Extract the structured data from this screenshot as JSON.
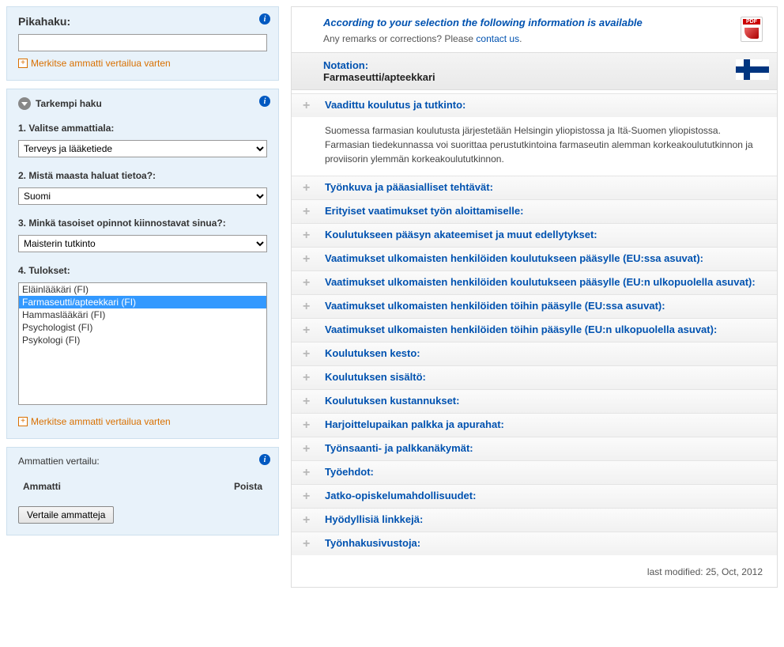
{
  "quicksearch": {
    "title": "Pikahaku:",
    "value": "",
    "mark_label": "Merkitse ammatti vertailua varten"
  },
  "advanced": {
    "title": "Tarkempi haku",
    "q1_label": "1. Valitse ammattiala:",
    "q1_value": "Terveys ja lääketiede",
    "q2_label": "2. Mistä maasta haluat tietoa?:",
    "q2_value": "Suomi",
    "q3_label": "3. Minkä tasoiset opinnot kiinnostavat sinua?:",
    "q3_value": "Maisterin tutkinto",
    "q4_label": "4. Tulokset:",
    "results": [
      "Eläinlääkäri (FI)",
      "Farmaseutti/apteekkari (FI)",
      "Hammaslääkäri (FI)",
      "Psychologist (FI)",
      "Psykologi (FI)"
    ],
    "selected_index": 1,
    "mark_label": "Merkitse ammatti vertailua varten"
  },
  "compare": {
    "title": "Ammattien vertailu:",
    "col_profession": "Ammatti",
    "col_remove": "Poista",
    "button": "Vertaile ammatteja"
  },
  "detail": {
    "intro": "According to your selection the following information is available",
    "remarks_prefix": "Any remarks or corrections? Please ",
    "contact_link": "contact us",
    "notation_label": "Notation:",
    "notation_value": "Farmaseutti/apteekkari",
    "expanded": {
      "title": "Vaadittu koulutus ja tutkinto:",
      "body": "Suomessa farmasian koulutusta järjestetään Helsingin yliopistossa ja Itä-Suomen yliopistossa. Farmasian tiedekunnassa voi suorittaa perustutkintoina farmaseutin alemman korkeakoulututkinnon ja proviisorin ylemmän korkeakoulututkinnon."
    },
    "sections": [
      "Työnkuva ja pääasialliset tehtävät:",
      "Erityiset vaatimukset työn aloittamiselle:",
      "Koulutukseen pääsyn akateemiset ja muut edellytykset:",
      "Vaatimukset ulkomaisten henkilöiden koulutukseen pääsylle (EU:ssa asuvat):",
      "Vaatimukset ulkomaisten henkilöiden koulutukseen pääsylle (EU:n ulkopuolella asuvat):",
      "Vaatimukset ulkomaisten henkilöiden töihin pääsylle (EU:ssa asuvat):",
      "Vaatimukset ulkomaisten henkilöiden töihin pääsylle (EU:n ulkopuolella asuvat):",
      "Koulutuksen kesto:",
      "Koulutuksen sisältö:",
      "Koulutuksen kustannukset:",
      "Harjoittelupaikan palkka ja apurahat:",
      "Työnsaanti- ja palkkanäkymät:",
      "Työehdot:",
      "Jatko-opiskelumahdollisuudet:",
      "Hyödyllisiä linkkejä:",
      "Työnhakusivustoja:"
    ],
    "last_modified": "last modified: 25, Oct, 2012"
  }
}
